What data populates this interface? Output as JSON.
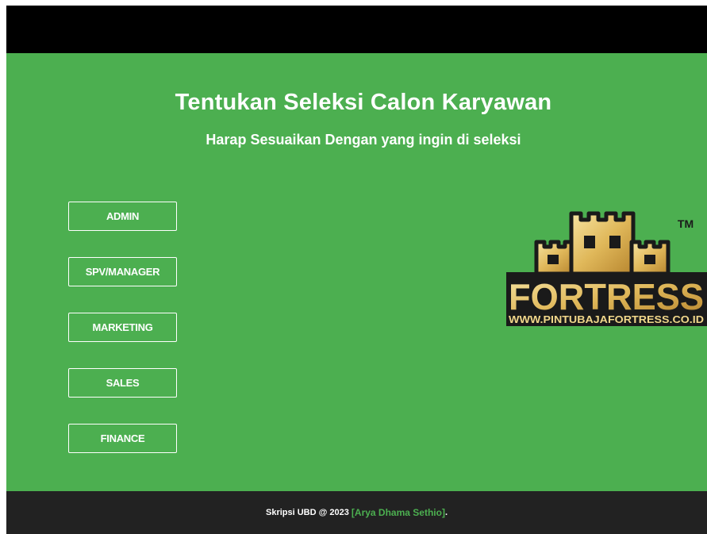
{
  "header": {
    "title": "Tentukan Seleksi Calon Karyawan",
    "subtitle": "Harap Sesuaikan Dengan yang ingin di seleksi"
  },
  "menu": {
    "items": [
      {
        "label": "ADMIN"
      },
      {
        "label": "SPV/MANAGER"
      },
      {
        "label": "MARKETING"
      },
      {
        "label": "SALES"
      },
      {
        "label": "FINANCE"
      }
    ]
  },
  "logo": {
    "brand": "FORTRESS",
    "website": "WWW.PINTUBAJAFORTRESS.CO.ID",
    "trademark": "TM"
  },
  "footer": {
    "prefix": "Skripsi UBD @ 2023 ",
    "author": "[Arya Dhama Sethio]",
    "suffix": "."
  },
  "colors": {
    "topbar": "#000000",
    "main_background": "#4caf50",
    "footer_background": "#222222",
    "accent": "#4caf50",
    "logo_gold": "#e8c36a",
    "logo_dark": "#1a1a1a"
  }
}
